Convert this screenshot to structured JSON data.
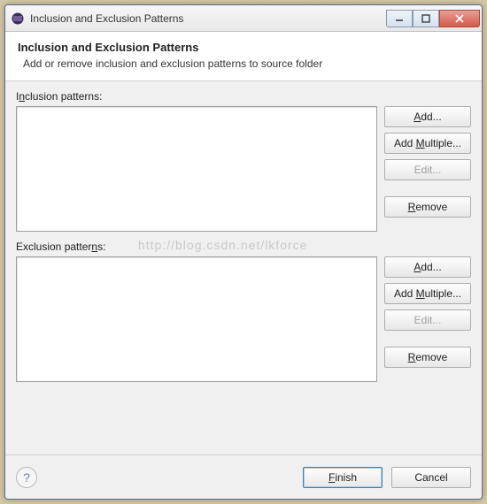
{
  "window": {
    "title": "Inclusion and Exclusion Patterns"
  },
  "header": {
    "title": "Inclusion and Exclusion Patterns",
    "subtitle": "Add or remove inclusion and exclusion patterns to source folder"
  },
  "inclusion": {
    "label_pre": "I",
    "label_u": "n",
    "label_post": "clusion patterns:",
    "items": [],
    "buttons": {
      "add": "Add...",
      "add_u": "A",
      "add_multiple": "Add Multiple...",
      "add_multiple_u": "M",
      "edit": "Edit...",
      "remove": "Remove",
      "remove_u": "R"
    }
  },
  "exclusion": {
    "label_pre": "Exclusion patter",
    "label_u": "n",
    "label_post": "s:",
    "items": [],
    "buttons": {
      "add": "Add...",
      "add_u": "A",
      "add_multiple": "Add Multiple...",
      "add_multiple_u": "M",
      "edit": "Edit...",
      "remove": "Remove",
      "remove_u": "R"
    }
  },
  "footer": {
    "finish": "Finish",
    "finish_u": "F",
    "cancel": "Cancel"
  },
  "watermark": "http://blog.csdn.net/lkforce"
}
